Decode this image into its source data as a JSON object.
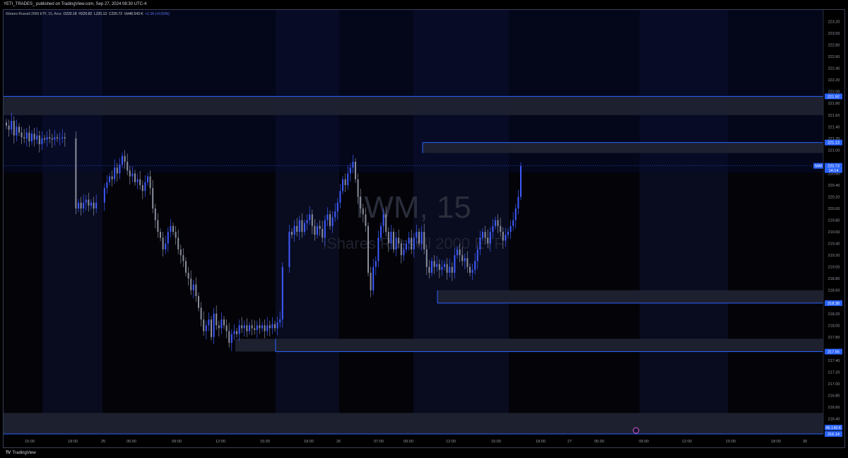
{
  "header": {
    "text": "YETI_TRADES_ published on TradingView.com, Sep 27, 2024 08:30 UTC-4"
  },
  "legend": {
    "name": "iShares Russell 2000 ETF, 15, Arca",
    "open": "O220.18",
    "high": "H220.82",
    "low": "L220.13",
    "close": "C220.73",
    "vol": "Vol46.543 K",
    "change": "+1.16 (+0.53%)"
  },
  "watermark": {
    "symbol": "IWM, 15",
    "name": "iShares Russell 2000 ETF"
  },
  "brand": {
    "logo": "TV",
    "name": "TradingView"
  },
  "colors": {
    "up": "#3d5afe",
    "down": "#8a8e9c",
    "zone_line": "#2962ff",
    "zone_fill": "#1f2230",
    "label_bg": "#2962ff",
    "axis_text": "#9598a1",
    "session_band": "#0a0d22"
  },
  "chart_data": {
    "type": "candlestick",
    "timeframe": "15",
    "ylim": [
      216.14,
      223.4
    ],
    "y_ticks": [
      "216.40",
      "216.60",
      "216.80",
      "217.00",
      "217.20",
      "217.40",
      "217.80",
      "218.00",
      "218.20",
      "218.60",
      "218.80",
      "219.00",
      "219.20",
      "219.40",
      "219.60",
      "219.80",
      "220.00",
      "220.20",
      "220.40",
      "220.60",
      "221.00",
      "221.20",
      "221.40",
      "221.60",
      "221.80",
      "222.00",
      "222.20",
      "222.40",
      "222.60",
      "222.80",
      "223.00",
      "223.20"
    ],
    "x_ticks": [
      "15:00",
      "18:00",
      "25",
      "06:00",
      "09:00",
      "12:00",
      "15:00",
      "18:00",
      "26",
      "07:00",
      "09:00",
      "12:00",
      "15:00",
      "18:00",
      "27",
      "06:00",
      "09:00",
      "12:00",
      "15:00",
      "18:00",
      "30"
    ],
    "price_labels": [
      {
        "value": 221.92,
        "text": "221.92"
      },
      {
        "value": 221.13,
        "text": "221.13"
      },
      {
        "value": 218.38,
        "text": "218.38"
      },
      {
        "value": 217.55,
        "text": "217.55"
      },
      {
        "value": 216.14,
        "text": "216.14"
      }
    ],
    "last_price": {
      "value": 220.73,
      "text": "220.73",
      "tag": "IWM",
      "countdown": "14:14"
    },
    "volume_label": {
      "text": "46.143 K"
    },
    "zones": [
      {
        "name": "upper-zone",
        "top": 221.92,
        "bottom": 221.6
      },
      {
        "name": "mid-zone",
        "top": 221.13,
        "bottom": 220.95
      },
      {
        "name": "support-zone",
        "top": 218.6,
        "bottom": 218.38
      },
      {
        "name": "low-zone",
        "top": 217.77,
        "bottom": 217.55
      },
      {
        "name": "bottom-zone",
        "top": 216.5,
        "bottom": 216.14
      }
    ],
    "closes": [
      221.42,
      221.35,
      221.5,
      221.25,
      221.4,
      221.3,
      221.22,
      221.2,
      221.3,
      221.15,
      221.28,
      221.18,
      221.25,
      221.1,
      221.2,
      221.18,
      221.22,
      221.2,
      221.18,
      221.22,
      221.2,
      221.2,
      221.22,
      221.2,
      220.0,
      220.1,
      220.0,
      220.1,
      220.15,
      220.05,
      220.1,
      220.0,
      220.1,
      220.35,
      220.45,
      220.55,
      220.5,
      220.7,
      220.6,
      220.75,
      220.9,
      220.8,
      220.65,
      220.55,
      220.6,
      220.45,
      220.5,
      220.4,
      220.3,
      220.45,
      220.55,
      220.35,
      220.0,
      219.8,
      219.6,
      219.5,
      219.3,
      219.4,
      219.6,
      219.7,
      219.6,
      219.5,
      219.3,
      219.2,
      219.1,
      218.9,
      218.8,
      218.6,
      218.7,
      218.5,
      218.3,
      218.1,
      217.9,
      218.0,
      218.1,
      217.8,
      218.2,
      218.0,
      217.95,
      218.1,
      218.0,
      217.9,
      217.7,
      217.85,
      217.9,
      217.85,
      218.0,
      217.95,
      218.0,
      217.9,
      218.0,
      217.95,
      217.92,
      218.0,
      217.95,
      218.0,
      217.9,
      218.0,
      217.95,
      218.02,
      217.95,
      218.05,
      218.1,
      219.0,
      219.6,
      219.55,
      219.7,
      219.6,
      219.8,
      219.6,
      219.75,
      219.8,
      219.9,
      219.7,
      219.55,
      219.7,
      219.65,
      219.5,
      219.8,
      219.9,
      219.7,
      219.85,
      219.95,
      220.1,
      220.3,
      220.5,
      220.4,
      220.6,
      220.7,
      220.8,
      220.5,
      220.2,
      220.0,
      219.9,
      219.7,
      218.9,
      218.6,
      219.0,
      219.1,
      219.5,
      219.7,
      219.9,
      219.6,
      219.4,
      219.6,
      219.3,
      219.5,
      219.4,
      219.2,
      219.3,
      219.4,
      219.5,
      219.3,
      219.5,
      219.6,
      219.4,
      219.6,
      219.3,
      219.0,
      218.9,
      219.1,
      219.0,
      219.05,
      218.95,
      219.0,
      219.05,
      218.9,
      219.0,
      218.9,
      219.2,
      219.3,
      219.2,
      219.1,
      219.15,
      219.0,
      218.9,
      218.95,
      219.1,
      219.3,
      219.5,
      219.6,
      219.5,
      219.4,
      219.6,
      219.7,
      219.8,
      219.7,
      219.6,
      219.45,
      219.55,
      219.6,
      219.7,
      219.8,
      220.0,
      220.2,
      220.73
    ]
  }
}
